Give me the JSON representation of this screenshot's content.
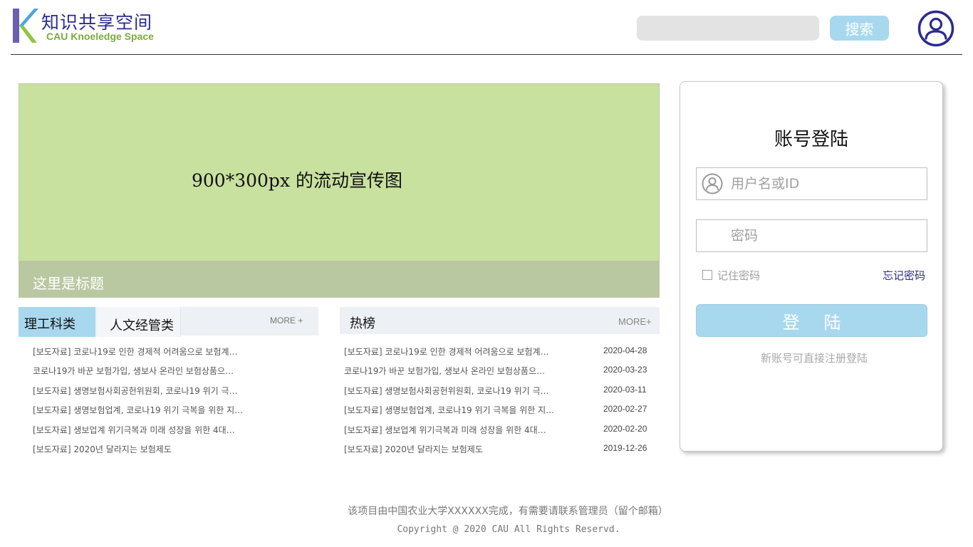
{
  "header": {
    "logo_title": "知识共享空间",
    "logo_subtitle": "CAU Knoeledge Space",
    "logo_icon": "k-logo-icon",
    "search_placeholder": "",
    "search_label": "搜索",
    "avatar_icon": "user-circle-icon"
  },
  "banner": {
    "text": "900*300px 的流动宣传图",
    "caption": "这里是标题"
  },
  "left_panel": {
    "tabs": [
      {
        "label": "理工科类"
      },
      {
        "label": "人文经管类"
      }
    ],
    "more_label": "MORE +",
    "items": [
      {
        "title": "[보도자료] 코로나19로 인한 경제적 어려움으로 보험계…"
      },
      {
        "title": "코로나19가 바꾼 보험가입, 생보사 온라인 보험상품으…"
      },
      {
        "title": "[보도자료] 생명보험사회공헌위원회, 코로나19 위기 극…"
      },
      {
        "title": "[보도자료] 생명보험업계, 코로나19 위기 극복을 위한 지…"
      },
      {
        "title": "[보도자료] 생보업계 위기극복과 미래 성장을 위한 4대…"
      },
      {
        "title": "[보도자료] 2020년 달라지는 보험제도"
      }
    ]
  },
  "right_panel": {
    "title": "热榜",
    "more_label": "MORE+",
    "items": [
      {
        "title": "[보도자료] 코로나19로 인한 경제적 어려움으로 보험계…",
        "date": "2020-04-28"
      },
      {
        "title": "코로나19가 바꾼 보험가입, 생보사 온라인 보험상품으…",
        "date": "2020-03-23"
      },
      {
        "title": "[보도자료] 생명보험사회공헌위원회, 코로나19 위기 극…",
        "date": "2020-03-11"
      },
      {
        "title": "[보도자료] 생명보험업계, 코로나19 위기 극복을 위한 지…",
        "date": "2020-02-27"
      },
      {
        "title": "[보도자료] 생보업계 위기극복과 미래 성장을 위한 4대…",
        "date": "2020-02-20"
      },
      {
        "title": "[보도자료] 2020년 달라지는 보험제도",
        "date": "2019-12-26"
      }
    ]
  },
  "login": {
    "title": "账号登陆",
    "username_placeholder": "用户名或ID",
    "password_placeholder": "密码",
    "remember_label": "记住密码",
    "forgot_label": "忘记密码",
    "submit_label": "登陆",
    "register_hint": "新账号可直接注册登陆",
    "user_icon": "user-circle-icon"
  },
  "footer": {
    "line1": "该项目由中国农业大学XXXXXX完成，有需要请联系管理员（留个邮箱）",
    "line2": "Copyright @ 2020 CAU All Rights Reservd."
  },
  "colors": {
    "brand_navy": "#2b2b8f",
    "accent_blue": "#a8d8ee",
    "banner_green": "#c9e19f",
    "caption_green": "#bac8a1",
    "logo_green": "#7aab3a"
  }
}
